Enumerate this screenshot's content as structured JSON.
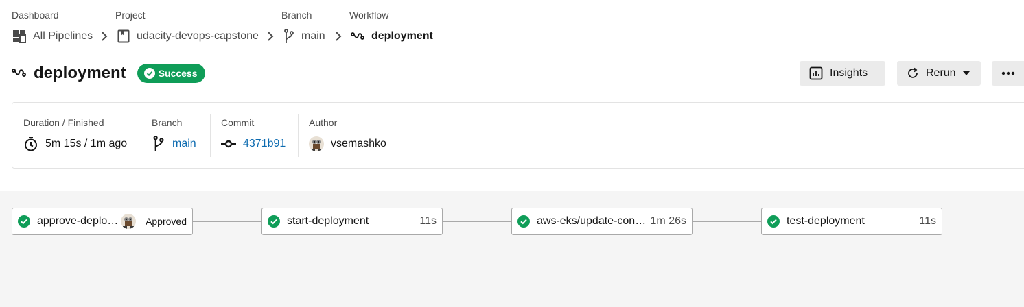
{
  "breadcrumb": {
    "dashboard": {
      "label": "Dashboard",
      "value": "All Pipelines"
    },
    "project": {
      "label": "Project",
      "value": "udacity-devops-capstone"
    },
    "branch": {
      "label": "Branch",
      "value": "main"
    },
    "workflow": {
      "label": "Workflow",
      "value": "deployment"
    }
  },
  "header": {
    "title": "deployment",
    "status": "Success",
    "insights_label": "Insights",
    "rerun_label": "Rerun"
  },
  "info": {
    "duration": {
      "label": "Duration / Finished",
      "value": "5m 15s / 1m ago"
    },
    "branch": {
      "label": "Branch",
      "value": "main"
    },
    "commit": {
      "label": "Commit",
      "value": "4371b91"
    },
    "author": {
      "label": "Author",
      "value": "vsemashko"
    }
  },
  "jobs": [
    {
      "name": "approve-deploy...",
      "status": "Approved"
    },
    {
      "name": "start-deployment",
      "duration": "11s"
    },
    {
      "name": "aws-eks/update-cont...",
      "duration": "1m 26s"
    },
    {
      "name": "test-deployment",
      "duration": "11s"
    }
  ],
  "colors": {
    "success": "#0f9d58",
    "link": "#0d6bb0",
    "button_bg": "#ebebeb",
    "graph_bg": "#f5f5f5"
  }
}
